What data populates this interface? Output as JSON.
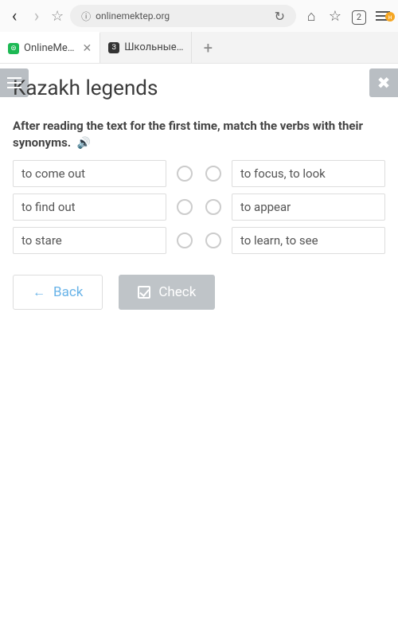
{
  "browser": {
    "url": "onlinemektep.org",
    "tab_count": "2",
    "notif": "н",
    "tabs": [
      {
        "title": "OnlineMe…",
        "active": true,
        "favicon": "green",
        "fchar": "⊜"
      },
      {
        "title": "Школьные…",
        "active": false,
        "favicon": "dark",
        "fchar": "З"
      }
    ]
  },
  "page": {
    "title": "Kazakh legends",
    "instruction": "After reading the text for the first time, match the verbs with their synonyms.",
    "left_items": [
      "to come out",
      "to find out",
      "to stare"
    ],
    "right_items": [
      "to focus, to look",
      "to appear",
      "to learn, to see"
    ],
    "back_label": "Back",
    "check_label": "Check"
  }
}
